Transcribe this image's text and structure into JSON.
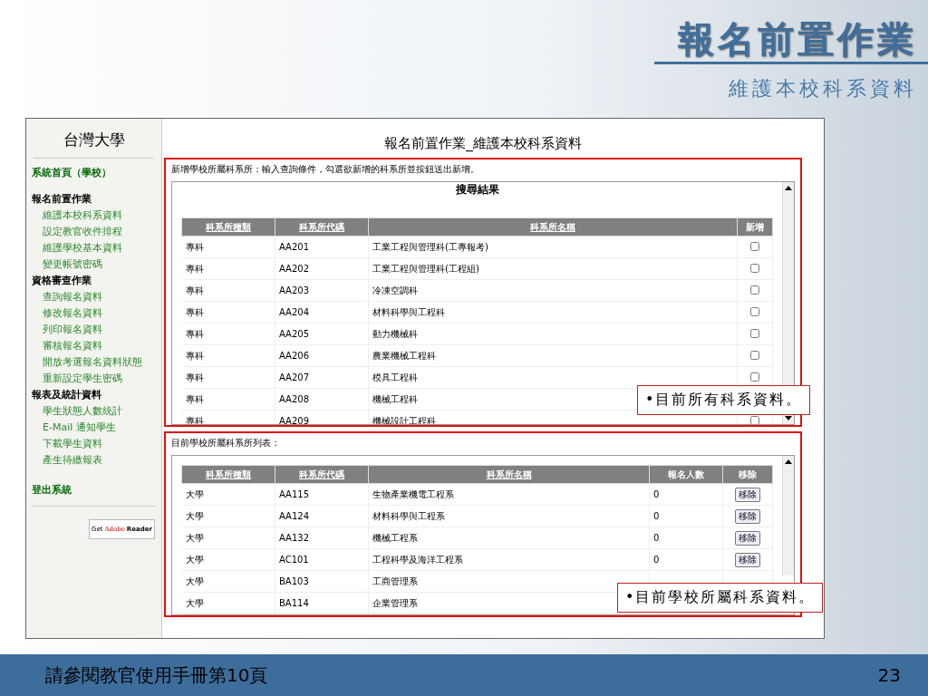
{
  "slide": {
    "title": "報名前置作業",
    "subtitle": "維護本校科系資料",
    "footer": "請參閱教官使用手冊第10頁",
    "page_number": "23"
  },
  "sidebar": {
    "school": "台灣大學",
    "home": "系統首頁（學校）",
    "sections": [
      {
        "title": "報名前置作業",
        "items": [
          "維護本校科系資料",
          "設定教官收件排程",
          "維護學校基本資料",
          "變更帳號密碼"
        ]
      },
      {
        "title": "資格審查作業",
        "items": [
          "查詢報名資料",
          "修改報名資料",
          "列印報名資料",
          "審核報名資料",
          "開放考選報名資料狀態",
          "重新設定學生密碼"
        ]
      },
      {
        "title": "報表及統計資料",
        "items": [
          "學生狀態人數統計",
          "E-Mail 通知學生",
          "下載學生資料",
          "產生待繳報表"
        ]
      }
    ],
    "logout": "登出系統",
    "reader_badge": {
      "get": "Get",
      "brand": "Adobe",
      "product": "Reader"
    }
  },
  "page_title": "報名前置作業_維護本校科系資料",
  "search_section": {
    "instruction": "新增學校所屬科系所：輸入查詢條件，勾選欲新增的科系所並按鈕送出新增。",
    "title": "搜尋結果",
    "columns": [
      {
        "label": "科系所種類",
        "sortable": true
      },
      {
        "label": "科系所代碼",
        "sortable": true
      },
      {
        "label": "科系所名稱",
        "sortable": true
      },
      {
        "label": "新增",
        "sortable": false
      }
    ],
    "rows": [
      {
        "type": "專科",
        "code": "AA201",
        "name": "工業工程與管理科(工專報考)",
        "checked": false
      },
      {
        "type": "專科",
        "code": "AA202",
        "name": "工業工程與管理科(工程組)",
        "checked": false
      },
      {
        "type": "專科",
        "code": "AA203",
        "name": "冷凍空調科",
        "checked": false
      },
      {
        "type": "專科",
        "code": "AA204",
        "name": "材料科學與工程科",
        "checked": false
      },
      {
        "type": "專科",
        "code": "AA205",
        "name": "動力機械科",
        "checked": false
      },
      {
        "type": "專科",
        "code": "AA206",
        "name": "農業機械工程科",
        "checked": false
      },
      {
        "type": "專科",
        "code": "AA207",
        "name": "模具工程科",
        "checked": false
      },
      {
        "type": "專科",
        "code": "AA208",
        "name": "機械工程科"
      },
      {
        "type": "專科",
        "code": "AA209",
        "name": "機械設計工程科",
        "checked": false
      }
    ]
  },
  "current_section": {
    "caption": "目前學校所屬科系所列表：",
    "columns": [
      {
        "label": "科系所種類",
        "sortable": true
      },
      {
        "label": "科系所代碼",
        "sortable": true
      },
      {
        "label": "科系所名稱",
        "sortable": true
      },
      {
        "label": "報名人數",
        "sortable": false
      },
      {
        "label": "移除",
        "sortable": false
      }
    ],
    "rows": [
      {
        "type": "大學",
        "code": "AA115",
        "name": "生物產業機電工程系",
        "count": "0",
        "button": "移除"
      },
      {
        "type": "大學",
        "code": "AA124",
        "name": "材料科學與工程系",
        "count": "0",
        "button": "移除"
      },
      {
        "type": "大學",
        "code": "AA132",
        "name": "機械工程系",
        "count": "0",
        "button": "移除"
      },
      {
        "type": "大學",
        "code": "AC101",
        "name": "工程科學及海洋工程系",
        "count": "0",
        "button": "移除"
      },
      {
        "type": "大學",
        "code": "BA103",
        "name": "工商管理系"
      },
      {
        "type": "大學",
        "code": "BA114",
        "name": "企業管理系"
      }
    ]
  },
  "callouts": [
    {
      "text": "•目前所有科系資料。"
    },
    {
      "text": "•目前學校所屬科系資料。"
    }
  ]
}
